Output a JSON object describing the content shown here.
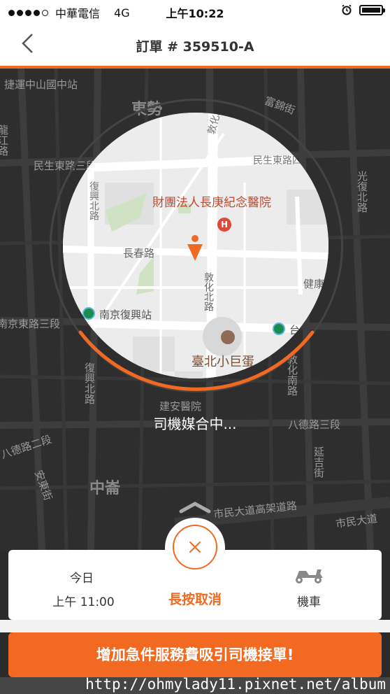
{
  "status": {
    "carrier": "中華電信",
    "network": "4G",
    "time": "上午10:22"
  },
  "nav": {
    "title": "訂單 # 359510-A"
  },
  "map": {
    "outer_labels": {
      "station": "捷運中山國中站",
      "east_power": "東勢",
      "fujin": "富錦街",
      "minsheng_e3": "民生東路三段",
      "longjiang": "龍江路",
      "guangfu_n": "光復北路",
      "nanjing_e3": "南京東路三段",
      "fuxing_n": "復興北路",
      "bade2": "八德路二段",
      "anlu": "安東街",
      "zhonglun": "中崙",
      "bade3": "八德路三段",
      "yanji": "延吉街",
      "expressway": "市民大道高架道路",
      "civic_blvd": "市民大道",
      "dunhua_s": "敦化南路",
      "jianan": "建安醫院"
    },
    "inner_labels": {
      "dunhua_n_top": "敦化北路",
      "minsheng_e_left": "民生東路三段",
      "minsheng_e_right": "民生東路四段",
      "fuxing_n": "復興北路",
      "hospital": "財團法人長庚紀念醫院",
      "changchun": "長春路",
      "dunhua_n_mid": "敦化北路",
      "jiankang": "健康路",
      "nanjing_fuxing": "南京復興站",
      "taipei_arena_station": "台北小巨蛋站",
      "taipei_arena": "臺北小巨蛋"
    },
    "matching_text": "司機媒合中..."
  },
  "card": {
    "date_label": "今日",
    "time_label": "上午 11:00",
    "cancel_label": "長按取消",
    "vehicle_label": "機車"
  },
  "cta_label": "增加急件服務費吸引司機接單!",
  "watermark": "http://ohmylady11.pixnet.net/album",
  "colors": {
    "accent": "#f26a22",
    "map_dark": "#2e2e2e"
  }
}
